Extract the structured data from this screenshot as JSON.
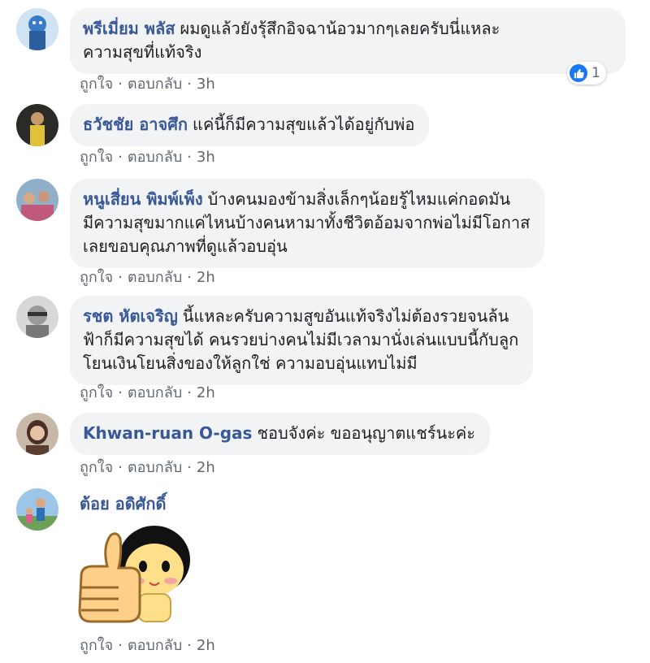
{
  "comments": [
    {
      "author": "พรีเมี่ยม พลัส",
      "text_lines": [
        "ผมดูแล้วยังรุ้สึกอิจฉาน้อวมากๆเลยครับนี่แหละ",
        "ความสุขที่แท้จริง"
      ],
      "like_label": "ถูกใจ",
      "reply_label": "ตอบกลับ",
      "separator": "·",
      "time": "3h",
      "reaction_count": "1",
      "avatar_color": "#3a7bc8"
    },
    {
      "author": "ธวัชชัย อาจศึก",
      "text_lines": [
        "แค่นี้ก็มีความสุขแล้วได้อยู่กับพ่อ"
      ],
      "like_label": "ถูกใจ",
      "reply_label": "ตอบกลับ",
      "separator": "·",
      "time": "3h",
      "avatar_color": "#6b5a3e"
    },
    {
      "author": "หนูเสี่ยน พิมพ์เพ็ง",
      "text_lines": [
        "บ้างคนมองข้ามสิ่งเล็กๆน้อยรู้ไหมแค่กอดมัน",
        "มีความสุขมากแค่ไหนบ้างคนหามาทั้งชีวิตอ้อมจากพ่อไม่มีโอกาส",
        "เลยขอบคุณภาพที่ดูแล้วอบอุ่น"
      ],
      "like_label": "ถูกใจ",
      "reply_label": "ตอบกลับ",
      "separator": "·",
      "time": "2h",
      "avatar_color": "#b98a6a"
    },
    {
      "author": "รชต หัตเจริญ",
      "text_lines": [
        "นี้แหละครับความสูขอันแท้จริงไม่ต้องรวยจนล้น",
        "ฟ้าก็มีความสุขได้ คนรวยบ่างคนไม่มีเวลามานั่งเล่นแบบนี้กับลูก",
        "โยนเงินโยนสิ่งของให้ลูกใช่ ความอบอุ่นแทบไม่มี"
      ],
      "like_label": "ถูกใจ",
      "reply_label": "ตอบกลับ",
      "separator": "·",
      "time": "2h",
      "avatar_color": "#9a9a9a"
    },
    {
      "author": "Khwan-ruan O-gas",
      "text_lines": [
        "ชอบจังค่ะ ขออนุญาตแชร์นะค่ะ"
      ],
      "like_label": "ถูกใจ",
      "reply_label": "ตอบกลับ",
      "separator": "·",
      "time": "2h",
      "avatar_color": "#7a5a48"
    },
    {
      "author": "ต้อย อดิศักดิ์",
      "text_lines": [],
      "like_label": "ถูกใจ",
      "reply_label": "ตอบกลับ",
      "separator": "·",
      "time": "2h",
      "avatar_color": "#6fa05a",
      "sticker": "thumbs-up-girl-sticker"
    }
  ],
  "colors": {
    "author": "#385898",
    "bubble_bg": "#f2f3f5",
    "meta_text": "#606770",
    "like_blue": "#1877f2"
  }
}
